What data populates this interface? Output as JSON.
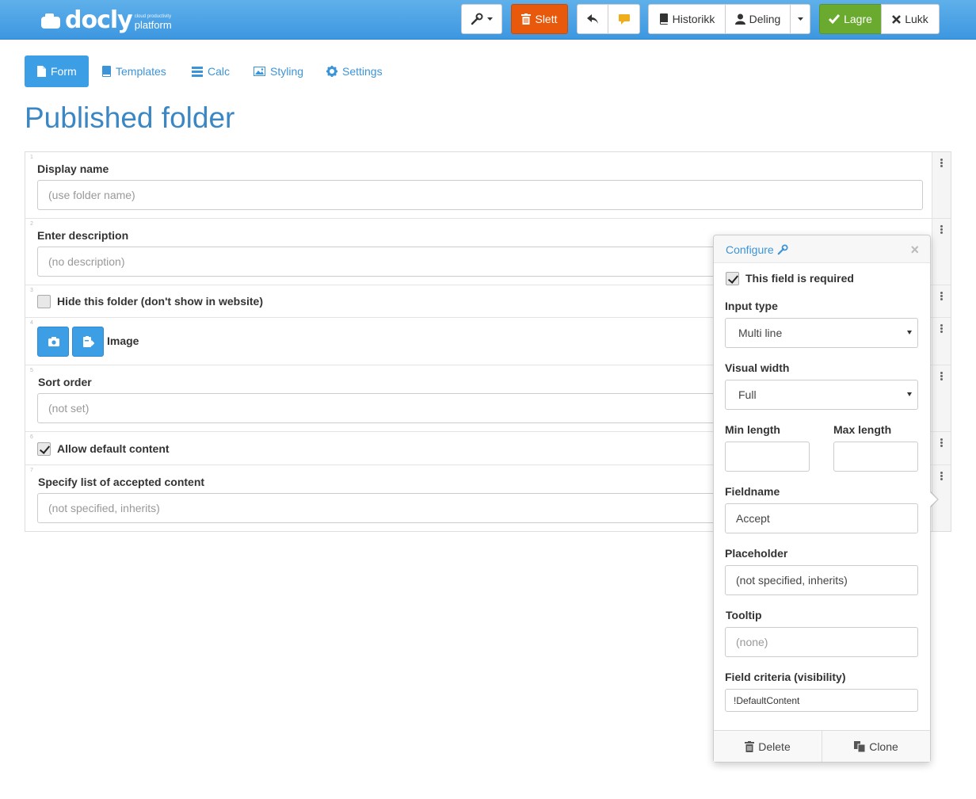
{
  "brand": {
    "name": "docly",
    "tagline": "cloud productivity",
    "sub": "platform"
  },
  "toolbar": {
    "delete_label": "Slett",
    "history_label": "Historikk",
    "share_label": "Deling",
    "save_label": "Lagre",
    "close_label": "Lukk"
  },
  "tabs": [
    {
      "label": "Form",
      "icon": "file-icon"
    },
    {
      "label": "Templates",
      "icon": "book-icon"
    },
    {
      "label": "Calc",
      "icon": "list-icon"
    },
    {
      "label": "Styling",
      "icon": "image-icon"
    },
    {
      "label": "Settings",
      "icon": "gear-icon"
    }
  ],
  "page_title": "Published folder",
  "form": {
    "rows": [
      {
        "num": "1",
        "label": "Display name",
        "placeholder": "(use folder name)"
      },
      {
        "num": "2",
        "label": "Enter description",
        "placeholder": "(no description)"
      },
      {
        "num": "3",
        "label": "Hide this folder (don't show in website)",
        "checked": false
      },
      {
        "num": "4",
        "label": "Image"
      },
      {
        "num": "5",
        "label": "Sort order",
        "placeholder": "(not set)"
      },
      {
        "num": "6",
        "label": "Allow default content",
        "checked": true
      },
      {
        "num": "7",
        "label": "Specify list of accepted content",
        "placeholder": "(not specified, inherits)"
      }
    ]
  },
  "configure": {
    "title": "Configure",
    "close": "×",
    "required_label": "This field is required",
    "required_checked": true,
    "input_type_label": "Input type",
    "input_type_value": "Multi line",
    "visual_width_label": "Visual width",
    "visual_width_value": "Full",
    "min_length_label": "Min length",
    "max_length_label": "Max length",
    "min_length_value": "",
    "max_length_value": "",
    "fieldname_label": "Fieldname",
    "fieldname_value": "Accept",
    "placeholder_label": "Placeholder",
    "placeholder_value": "(not specified, inherits)",
    "tooltip_label": "Tooltip",
    "tooltip_placeholder": "(none)",
    "criteria_label": "Field criteria (visibility)",
    "criteria_value": "!DefaultContent",
    "delete_label": "Delete",
    "clone_label": "Clone"
  },
  "colors": {
    "primary": "#3c9ee5",
    "danger": "#e8590c",
    "success": "#6aaa2e",
    "title": "#3a87c4"
  }
}
